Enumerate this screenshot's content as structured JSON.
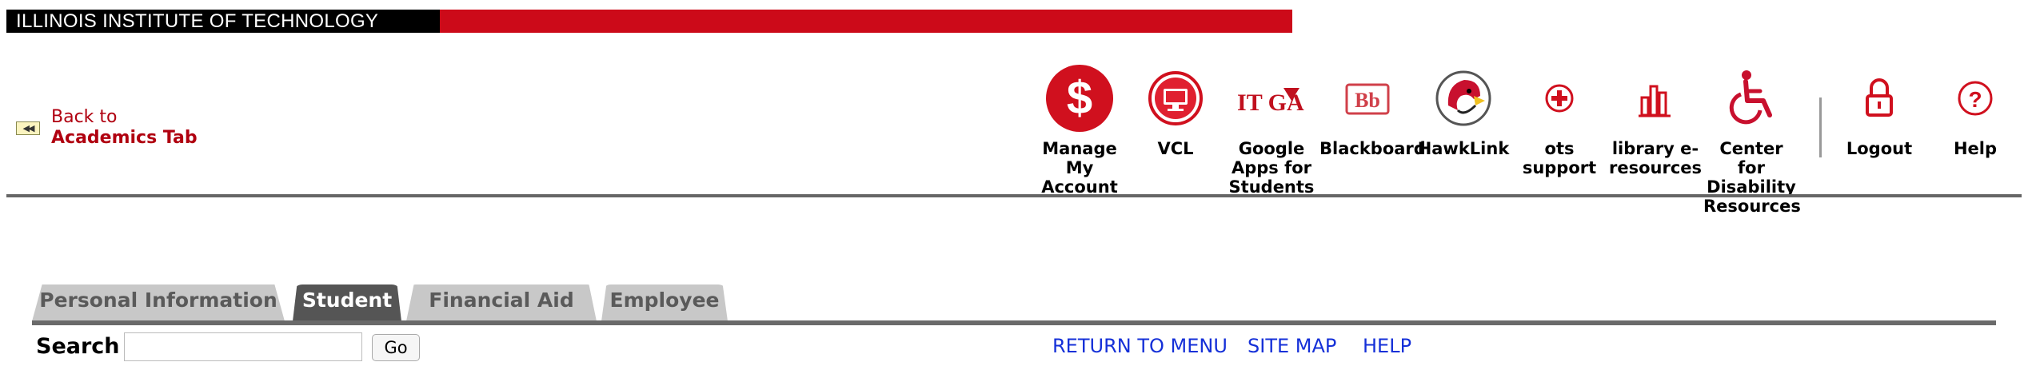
{
  "banner": {
    "title": "ILLINOIS INSTITUTE OF TECHNOLOGY"
  },
  "back": {
    "button_glyph": "◀◀",
    "line1": "Back to",
    "line2": "Academics Tab"
  },
  "toolbar": {
    "items": [
      {
        "label": "Manage My Account",
        "icon": "dollar-icon"
      },
      {
        "label": "VCL",
        "icon": "monitor-icon"
      },
      {
        "label": "Google Apps for Students",
        "icon": "google-apps-icon"
      },
      {
        "label": "Blackboard",
        "icon": "blackboard-icon"
      },
      {
        "label": "HawkLink",
        "icon": "hawk-icon"
      },
      {
        "label": "ots support",
        "icon": "plus-icon"
      },
      {
        "label": "library e-resources",
        "icon": "library-icon"
      },
      {
        "label": "Center for Disability Resources",
        "icon": "wheelchair-icon"
      },
      {
        "label": "Logout",
        "icon": "lock-icon"
      },
      {
        "label": "Help",
        "icon": "question-icon"
      }
    ],
    "google_icon_text": "IIT GA",
    "blackboard_icon_text": "Bb"
  },
  "tabs": [
    {
      "label": "Personal Information",
      "active": false
    },
    {
      "label": "Student",
      "active": true
    },
    {
      "label": "Financial Aid",
      "active": false
    },
    {
      "label": "Employee",
      "active": false
    }
  ],
  "search": {
    "label": "Search",
    "value": "",
    "go_label": "Go"
  },
  "links": {
    "return_to_menu": "RETURN TO MENU",
    "site_map": "SITE MAP",
    "help": "HELP"
  },
  "colors": {
    "brand_red": "#cc0a19",
    "link_blue": "#1530d8",
    "tab_gray": "#c8c8c8",
    "tab_active": "#555555"
  }
}
